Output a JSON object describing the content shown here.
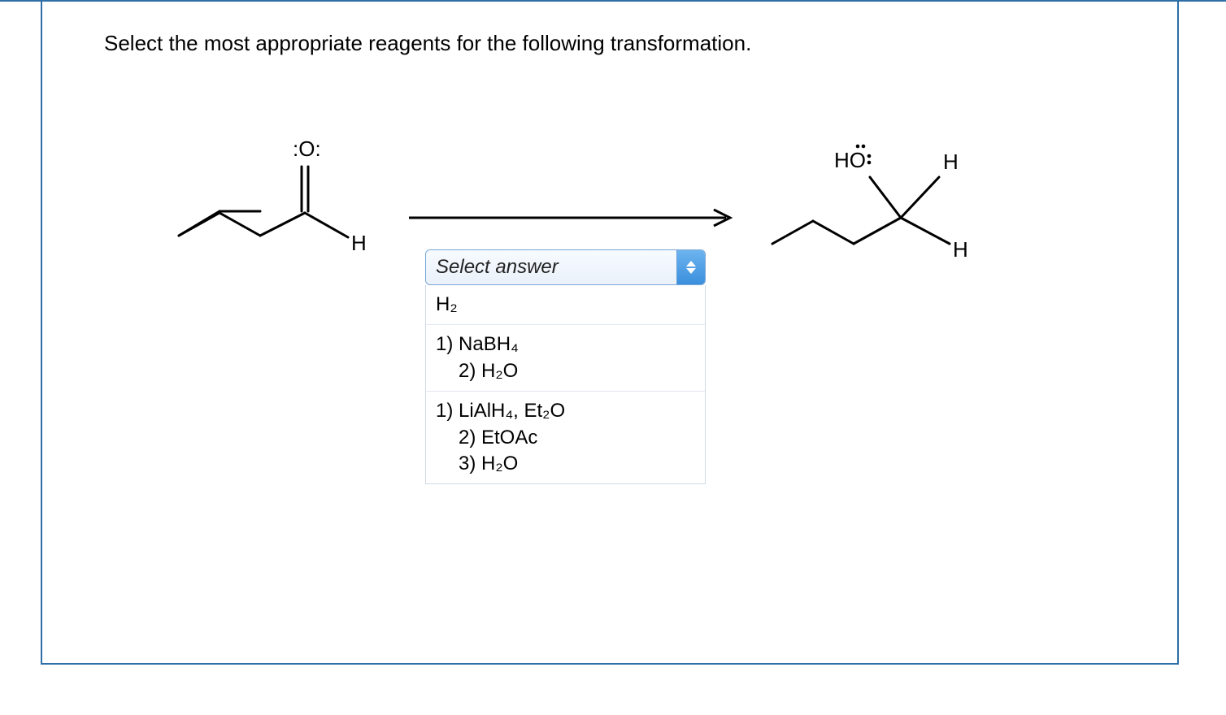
{
  "question": "Select the most appropriate reagents for the following transformation.",
  "reactant": {
    "o_label": ":O:",
    "h_label": "H"
  },
  "product": {
    "ho_label": "HO",
    "h_top_label": "H",
    "h_right_label": "H"
  },
  "dropdown": {
    "placeholder": "Select answer",
    "options": [
      {
        "line1": "H₂"
      },
      {
        "line1": "1) NaBH₄",
        "line2": "2) H₂O"
      },
      {
        "line1": "1) LiAlH₄, Et₂O",
        "line2": "2) EtOAc",
        "line3": "3) H₂O"
      }
    ]
  }
}
